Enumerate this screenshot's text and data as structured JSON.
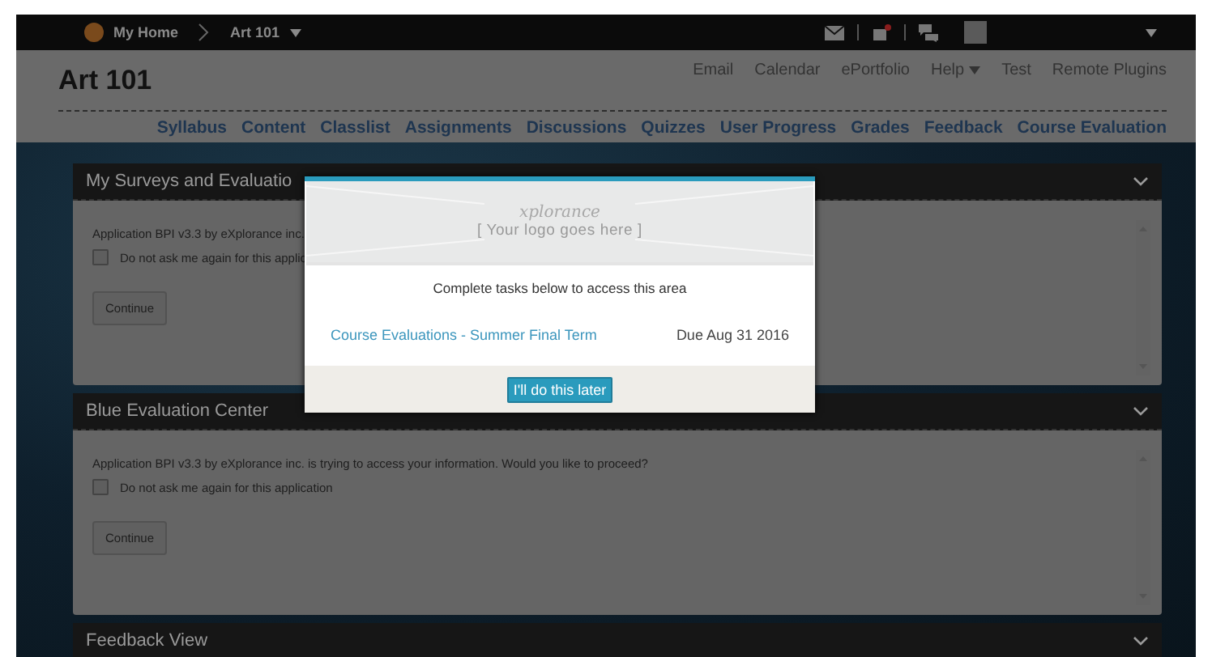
{
  "top_bar": {
    "home": "My Home",
    "course": "Art 101"
  },
  "header": {
    "title": "Art 101",
    "links": [
      {
        "label": "Email",
        "kind": "plain"
      },
      {
        "label": "Calendar",
        "kind": "plain"
      },
      {
        "label": "ePortfolio",
        "kind": "plain"
      },
      {
        "label": "Help",
        "kind": "menu"
      },
      {
        "label": "Test",
        "kind": "plain"
      },
      {
        "label": "Remote Plugins",
        "kind": "plain"
      }
    ]
  },
  "nav": [
    "Syllabus",
    "Content",
    "Classlist",
    "Assignments",
    "Discussions",
    "Quizzes",
    "User Progress",
    "Grades",
    "Feedback",
    "Course Evaluation"
  ],
  "panels": [
    {
      "title": "My Surveys and Evaluatio",
      "message": "Application BPI v3.3 by eXplorance inc.",
      "checkbox": {
        "label": "Do not ask me again for this applic",
        "checked": false
      },
      "button": "Continue"
    },
    {
      "title": "Blue Evaluation Center",
      "message": "Application BPI v3.3 by eXplorance inc. is trying to access your information. Would you like to proceed?",
      "checkbox": {
        "label": "Do not ask me again for this application",
        "checked": false
      },
      "button": "Continue"
    },
    {
      "title": "Feedback View"
    }
  ],
  "modal": {
    "brand": "xplorance",
    "logo_placeholder": "[ Your logo goes here ]",
    "instruction": "Complete tasks below to access this area",
    "tasks": [
      {
        "link": "Course Evaluations - Summer Final Term",
        "due": "Due Aug 31 2016"
      }
    ],
    "button": "I'll do this later"
  }
}
